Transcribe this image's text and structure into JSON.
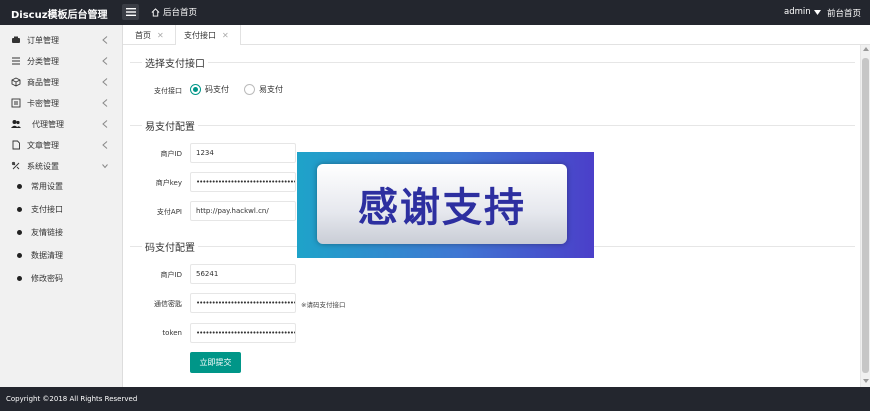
{
  "header": {
    "brand": "Discuz模板后台管理",
    "home_link": "后台首页",
    "user": "admin",
    "front_link": "前台首页"
  },
  "sidebar": {
    "items": [
      {
        "label": "订单管理",
        "icon": "order-icon"
      },
      {
        "label": "分类管理",
        "icon": "category-icon"
      },
      {
        "label": "商品管理",
        "icon": "product-icon"
      },
      {
        "label": "卡密管理",
        "icon": "card-icon"
      },
      {
        "label": "代理管理",
        "icon": "users-icon"
      },
      {
        "label": "文章管理",
        "icon": "article-icon"
      },
      {
        "label": "系统设置",
        "icon": "settings-icon"
      }
    ],
    "sub_items": [
      {
        "label": "常用设置"
      },
      {
        "label": "支付接口"
      },
      {
        "label": "友情链接"
      },
      {
        "label": "数据清理"
      },
      {
        "label": "修改密码"
      }
    ]
  },
  "tabs": [
    {
      "label": "首页"
    },
    {
      "label": "支付接口"
    }
  ],
  "sections": {
    "select": {
      "title": "选择支付接口",
      "label": "支付接口",
      "options": [
        "码支付",
        "易支付"
      ],
      "selected": "码支付"
    },
    "epay": {
      "title": "易支付配置",
      "fields": [
        {
          "label": "商户ID",
          "value": "1234"
        },
        {
          "label": "商户key",
          "value": "••••••••••••••••••••••••••••••••••••••"
        },
        {
          "label": "支付API",
          "value": "http://pay.hackwl.cn/"
        }
      ]
    },
    "codepay": {
      "title": "码支付配置",
      "fields": [
        {
          "label": "商户ID",
          "value": "56241"
        },
        {
          "label": "通信密匙",
          "value": "••••••••••••••••••••••••••••••••••••••"
        },
        {
          "label": "token",
          "value": "••••••••••••••••••••••••••••••••••••••"
        }
      ],
      "tip": "※请码支付接口"
    }
  },
  "submit_label": "立即提交",
  "banner_text": "感谢支持",
  "footer": "Copyright ©2018 All Rights Reserved",
  "colors": {
    "accent": "#009688",
    "header_bg": "#23262e"
  }
}
